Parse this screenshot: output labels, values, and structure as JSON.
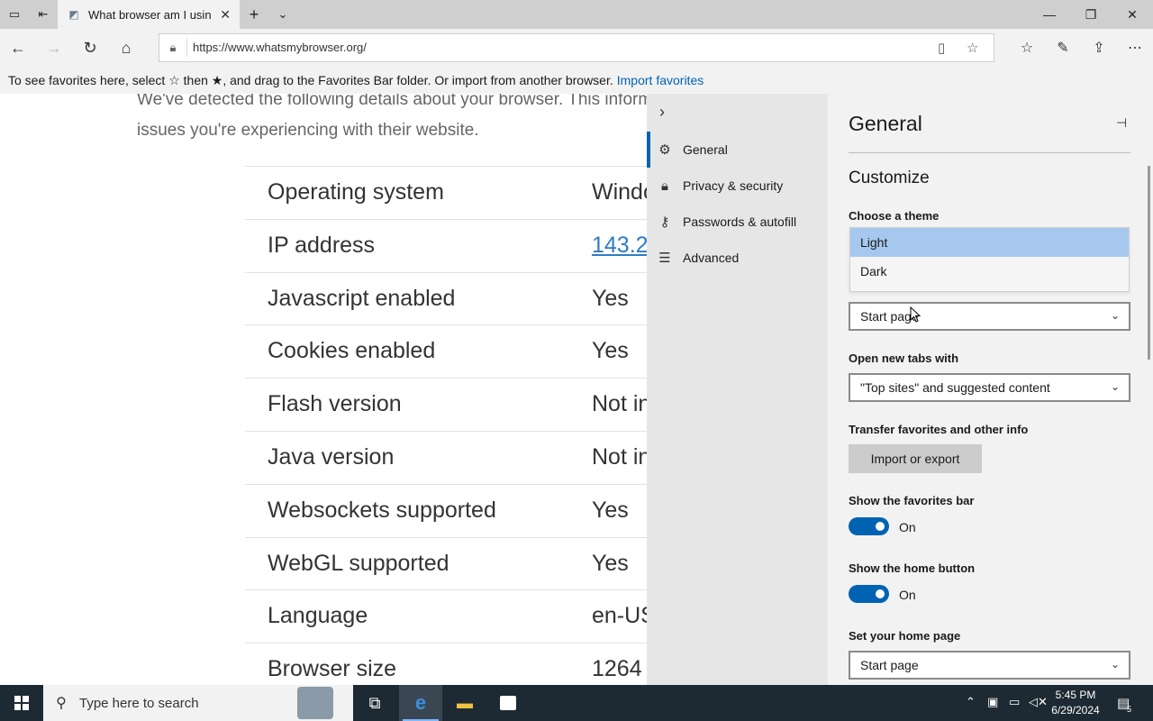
{
  "browser": {
    "tab_title": "What browser am I usin",
    "url": "https://www.whatsmybrowser.org/"
  },
  "favorites_bar": {
    "message": "To see favorites here, select ☆ then ★, and drag to the Favorites Bar folder. Or import from another browser.",
    "link": "Import favorites"
  },
  "page": {
    "intro_line1": "We've detected the following details about your browser. This inform",
    "intro_line2": "issues you're experiencing with their website.",
    "rows": [
      {
        "key": "Operating system",
        "value": "Windo"
      },
      {
        "key": "IP address",
        "value": "143.2"
      },
      {
        "key": "Javascript enabled",
        "value": "Yes"
      },
      {
        "key": "Cookies enabled",
        "value": "Yes"
      },
      {
        "key": "Flash version",
        "value": "Not in"
      },
      {
        "key": "Java version",
        "value": "Not in"
      },
      {
        "key": "Websockets supported",
        "value": "Yes"
      },
      {
        "key": "WebGL supported",
        "value": "Yes"
      },
      {
        "key": "Language",
        "value": "en-US"
      },
      {
        "key": "Browser size",
        "value": "1264"
      }
    ]
  },
  "settings_nav": {
    "items": [
      {
        "label": "General",
        "icon": "gear-icon"
      },
      {
        "label": "Privacy & security",
        "icon": "lock-icon"
      },
      {
        "label": "Passwords & autofill",
        "icon": "key-icon"
      },
      {
        "label": "Advanced",
        "icon": "sliders-icon"
      }
    ]
  },
  "settings": {
    "title": "General",
    "section": "Customize",
    "theme_label": "Choose a theme",
    "theme_options": [
      "Light",
      "Dark"
    ],
    "open_with_value": "Start page",
    "new_tabs_label": "Open new tabs with",
    "new_tabs_value": "\"Top sites\" and suggested content",
    "transfer_label": "Transfer favorites and other info",
    "import_button": "Import or export",
    "fav_bar_label": "Show the favorites bar",
    "fav_bar_state": "On",
    "home_btn_label": "Show the home button",
    "home_btn_state": "On",
    "home_page_label": "Set your home page",
    "home_page_value": "Start page"
  },
  "taskbar": {
    "search_placeholder": "Type here to search",
    "time": "5:45 PM",
    "date": "6/29/2024",
    "notifications": "5"
  },
  "colors": {
    "accent": "#0063b1",
    "selected_option": "#a6c8ee"
  }
}
